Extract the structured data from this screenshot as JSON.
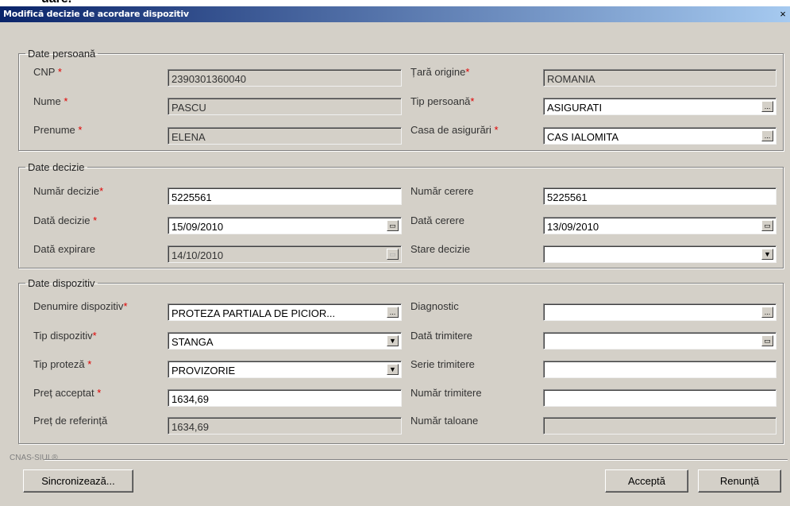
{
  "page_top": {
    "text": "uare."
  },
  "window": {
    "title": "Modifică decizie de acordare dispozitiv",
    "close": "×"
  },
  "persoana": {
    "legend": "Date persoană",
    "cnp_label": "CNP",
    "cnp": "2390301360040",
    "tara_label": "Țară origine",
    "tara": "ROMANIA",
    "nume_label": "Nume",
    "nume": "PASCU",
    "tip_label": "Tip persoană",
    "tip": "ASIGURATI",
    "prenume_label": "Prenume",
    "prenume": "ELENA",
    "casa_label": "Casa de asigurări",
    "casa": "CAS IALOMITA"
  },
  "decizie": {
    "legend": "Date decizie",
    "nr_decizie_label": "Număr decizie",
    "nr_decizie": "5225561",
    "nr_cerere_label": "Număr cerere",
    "nr_cerere": "5225561",
    "data_decizie_label": "Dată decizie",
    "data_decizie": "15/09/2010",
    "data_cerere_label": "Dată cerere",
    "data_cerere": "13/09/2010",
    "data_expirare_label": "Dată expirare",
    "data_expirare": "14/10/2010",
    "stare_label": "Stare decizie",
    "stare": ""
  },
  "dispozitiv": {
    "legend": "Date dispozitiv",
    "denumire_label": "Denumire dispozitiv",
    "denumire": "PROTEZA PARTIALA DE PICIOR...",
    "diagnostic_label": "Diagnostic",
    "diagnostic": "",
    "tip_disp_label": "Tip dispozitiv",
    "tip_disp": "STANGA",
    "data_trimitere_label": "Dată trimitere",
    "data_trimitere": "",
    "tip_proteza_label": "Tip proteză",
    "tip_proteza": "PROVIZORIE",
    "serie_trimitere_label": "Serie trimitere",
    "serie_trimitere": "",
    "pret_acceptat_label": "Preț acceptat",
    "pret_acceptat": "1634,69",
    "nr_trimitere_label": "Număr trimitere",
    "nr_trimitere": "",
    "pret_referinta_label": "Preț de referință",
    "pret_referinta": "1634,69",
    "nr_taloane_label": "Număr taloane",
    "nr_taloane": ""
  },
  "footer": {
    "brand": "CNAS-SIUI ®",
    "sync": "Sincronizează...",
    "accept": "Acceptă",
    "cancel": "Renunță"
  },
  "icons": {
    "required": "*",
    "ellipsis": "...",
    "dropdown": "▼",
    "calendar": "▭"
  }
}
